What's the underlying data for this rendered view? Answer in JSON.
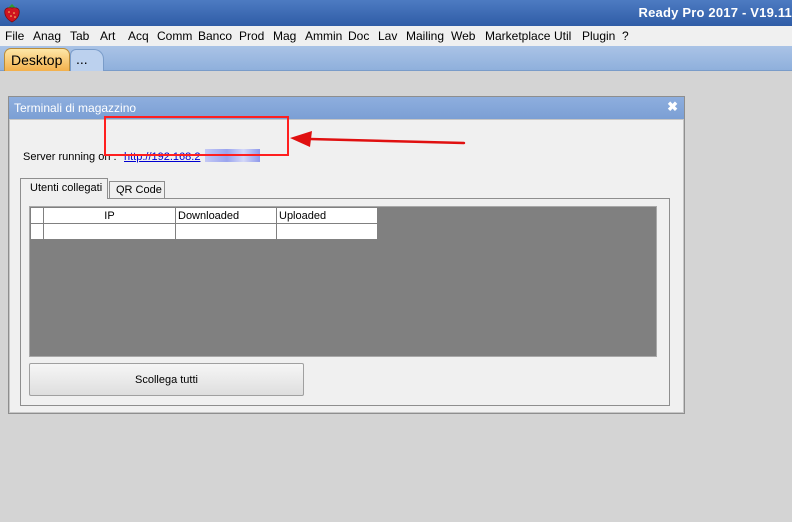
{
  "app": {
    "title": "Ready Pro 2017 - V19.11",
    "logo_icon": "strawberry-icon"
  },
  "menu": [
    "File",
    "Anag",
    "Tab",
    "Art",
    "Acq",
    "Comm",
    "Banco",
    "Prod",
    "Mag",
    "Ammin",
    "Doc",
    "Lav",
    "Mailing",
    "Web",
    "Marketplace",
    "Util",
    "Plugin",
    "?"
  ],
  "tabs": {
    "desktop": "Desktop",
    "more": "..."
  },
  "dialog": {
    "title": "Terminali di magazzino",
    "close_icon": "close-icon",
    "server_label": "Server running on :",
    "server_url": "http://192.168.2",
    "tabs": [
      "Utenti collegati",
      "QR Code"
    ],
    "table": {
      "columns": [
        "",
        "IP",
        "Downloaded",
        "Uploaded"
      ],
      "rows": [
        [
          "",
          "",
          "",
          ""
        ]
      ]
    },
    "disconnect_button": "Scollega tutti"
  },
  "annotation": {
    "color": "#ff1f1f"
  },
  "colors": {
    "title_bar": "#2f5ca6",
    "dialog_title_bar": "#7b9fd4",
    "active_tab": "#f3b04c",
    "grid_background": "#808080",
    "link": "#0000d0"
  }
}
